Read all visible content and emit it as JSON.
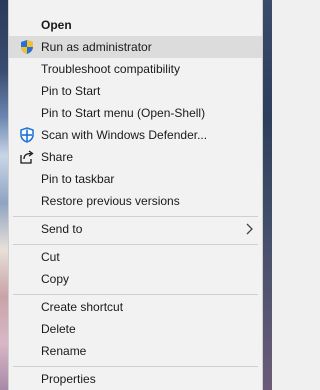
{
  "context_menu": {
    "items": [
      {
        "label": "Open",
        "icon": null
      },
      {
        "label": "Run as administrator",
        "icon": "uac-shield-icon"
      },
      {
        "label": "Troubleshoot compatibility",
        "icon": null
      },
      {
        "label": "Pin to Start",
        "icon": null
      },
      {
        "label": "Pin to Start menu (Open-Shell)",
        "icon": null
      },
      {
        "label": "Scan with Windows Defender...",
        "icon": "windows-defender-icon"
      },
      {
        "label": "Share",
        "icon": "share-icon"
      },
      {
        "label": "Pin to taskbar",
        "icon": null
      },
      {
        "label": "Restore previous versions",
        "icon": null
      },
      {
        "label": "Send to",
        "icon": "chevron-right-icon"
      },
      {
        "label": "Cut",
        "icon": null
      },
      {
        "label": "Copy",
        "icon": null
      },
      {
        "label": "Create shortcut",
        "icon": null
      },
      {
        "label": "Delete",
        "icon": null
      },
      {
        "label": "Rename",
        "icon": null
      },
      {
        "label": "Properties",
        "icon": null
      }
    ],
    "highlighted_item": "Run as administrator",
    "colors": {
      "menu_background": "#f2f2f2",
      "highlight": "#dcdcdc",
      "shield_blue": "#2b6fd6",
      "shield_yellow": "#f2c12e",
      "defender_blue": "#1a73d6"
    }
  }
}
